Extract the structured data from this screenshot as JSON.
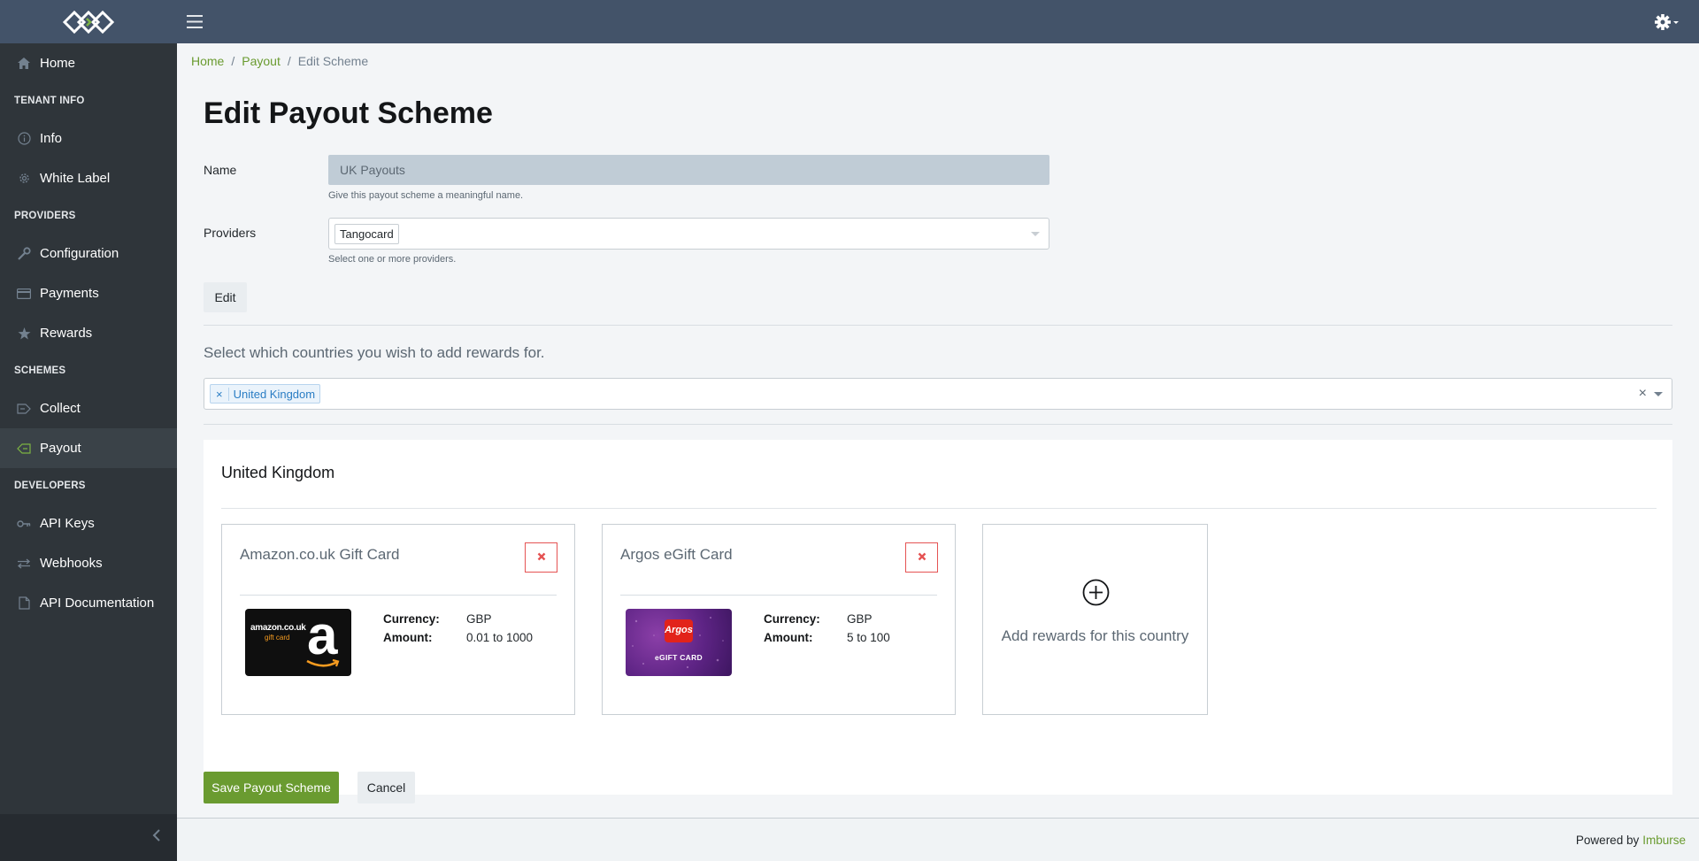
{
  "header": {
    "logo_icon": "imburse-logo-icon",
    "menu_icon": "hamburger-icon",
    "settings_icon": "gear-icon"
  },
  "sidebar": {
    "home": "Home",
    "section_tenant": "TENANT INFO",
    "info": "Info",
    "white_label": "White Label",
    "section_providers": "PROVIDERS",
    "configuration": "Configuration",
    "payments": "Payments",
    "rewards": "Rewards",
    "section_schemes": "SCHEMES",
    "collect": "Collect",
    "payout": "Payout",
    "section_developers": "DEVELOPERS",
    "api_keys": "API Keys",
    "webhooks": "Webhooks",
    "api_docs": "API Documentation"
  },
  "breadcrumb": {
    "home": "Home",
    "sep": "/",
    "payout": "Payout",
    "current": "Edit Scheme"
  },
  "page": {
    "title": "Edit Payout Scheme"
  },
  "form": {
    "name_label": "Name",
    "name_value": "UK Payouts",
    "name_help": "Give this payout scheme a meaningful name.",
    "providers_label": "Providers",
    "provider_tag": "Tangocard",
    "providers_help": "Select one or more providers.",
    "edit_button": "Edit",
    "countries_prompt": "Select which countries you wish to add rewards for.",
    "country_tag": "United Kingdom",
    "tag_remove": "×",
    "clear_all": "×"
  },
  "country_panel": {
    "title": "United Kingdom",
    "cards": [
      {
        "title": "Amazon.co.uk Gift Card",
        "currency_label": "Currency:",
        "currency": "GBP",
        "amount_label": "Amount:",
        "amount": "0.01 to 1000",
        "image_text_main": "amazon.co.uk",
        "image_text_sub": "gift card",
        "image_letter": "a"
      },
      {
        "title": "Argos eGift Card",
        "currency_label": "Currency:",
        "currency": "GBP",
        "amount_label": "Amount:",
        "amount": "5 to 100",
        "image_text_main": "Argos",
        "image_text_sub": "eGIFT CARD"
      }
    ],
    "add_text": "Add rewards for this country"
  },
  "actions": {
    "save": "Save Payout Scheme",
    "cancel": "Cancel"
  },
  "footer": {
    "powered_by": "Powered by",
    "brand": "Imburse"
  },
  "colors": {
    "header": "#435369",
    "sidebar": "#2f353a",
    "accent": "#6a9b30",
    "danger": "#e55353"
  }
}
